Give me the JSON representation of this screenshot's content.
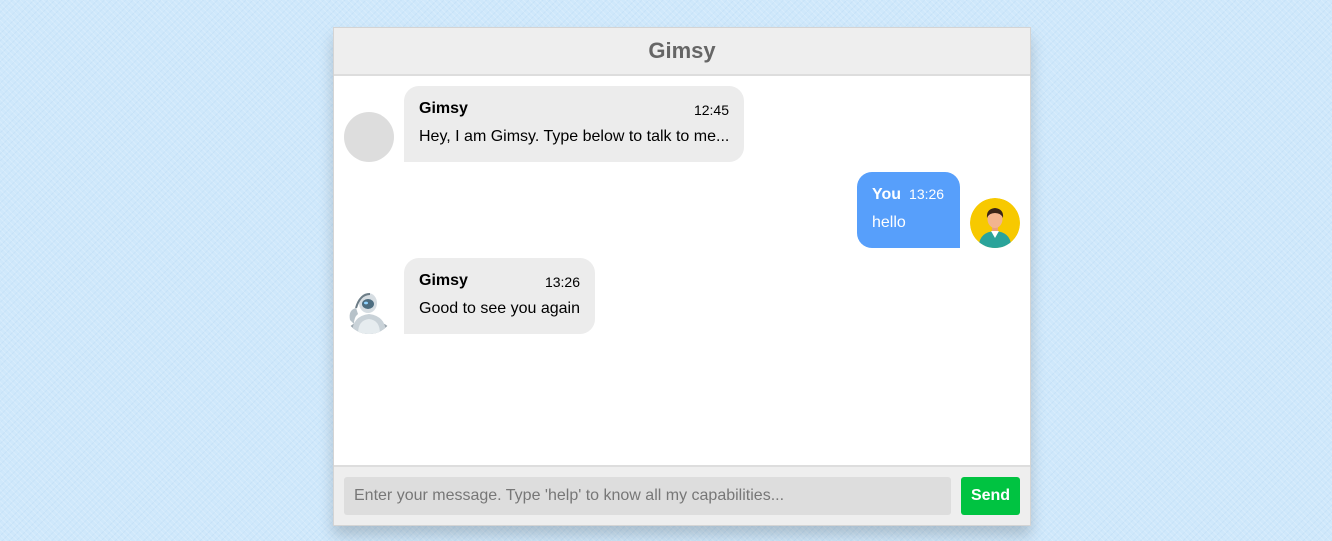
{
  "header": {
    "title": "Gimsy"
  },
  "messages": [
    {
      "sender": "Gimsy",
      "time": "12:45",
      "text": "Hey, I am Gimsy. Type below to talk to me...",
      "side": "left",
      "avatar": "blank-avatar-icon"
    },
    {
      "sender": "You",
      "time": "13:26",
      "text": "hello",
      "side": "right",
      "avatar": "user-avatar-icon"
    },
    {
      "sender": "Gimsy",
      "time": "13:26",
      "text": "Good to see you again",
      "side": "left",
      "avatar": "robot-avatar-icon"
    }
  ],
  "composer": {
    "placeholder": "Enter your message. Type 'help' to know all my capabilities...",
    "value": "",
    "send_label": "Send"
  },
  "colors": {
    "bot_bubble": "#ececec",
    "user_bubble": "#579ffb",
    "send_button": "#00c341",
    "header_bg": "#eeeeee",
    "page_bg": "#cfe8fb"
  }
}
